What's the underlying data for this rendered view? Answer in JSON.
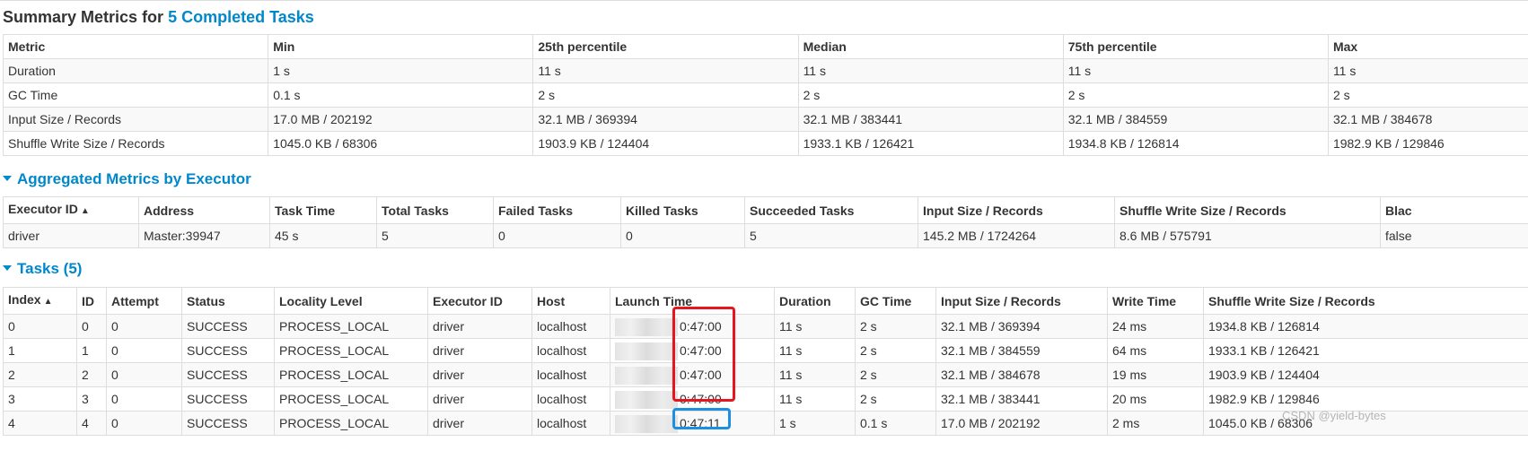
{
  "summary": {
    "title_prefix": "Summary Metrics for ",
    "title_link": "5 Completed Tasks",
    "headers": [
      "Metric",
      "Min",
      "25th percentile",
      "Median",
      "75th percentile",
      "Max"
    ],
    "rows": [
      [
        "Duration",
        "1 s",
        "11 s",
        "11 s",
        "11 s",
        "11 s"
      ],
      [
        "GC Time",
        "0.1 s",
        "2 s",
        "2 s",
        "2 s",
        "2 s"
      ],
      [
        "Input Size / Records",
        "17.0 MB / 202192",
        "32.1 MB / 369394",
        "32.1 MB / 383441",
        "32.1 MB / 384559",
        "32.1 MB / 384678"
      ],
      [
        "Shuffle Write Size / Records",
        "1045.0 KB / 68306",
        "1903.9 KB / 124404",
        "1933.1 KB / 126421",
        "1934.8 KB / 126814",
        "1982.9 KB / 129846"
      ]
    ]
  },
  "executors": {
    "title": "Aggregated Metrics by Executor",
    "headers": [
      "Executor ID",
      "Address",
      "Task Time",
      "Total Tasks",
      "Failed Tasks",
      "Killed Tasks",
      "Succeeded Tasks",
      "Input Size / Records",
      "Shuffle Write Size / Records",
      "Blac"
    ],
    "sort_indicator": "▲",
    "rows": [
      [
        "driver",
        "Master:39947",
        "45 s",
        "5",
        "0",
        "0",
        "5",
        "145.2 MB / 1724264",
        "8.6 MB / 575791",
        "false"
      ]
    ]
  },
  "tasks": {
    "title": "Tasks (5)",
    "headers": [
      "Index",
      "ID",
      "Attempt",
      "Status",
      "Locality Level",
      "Executor ID",
      "Host",
      "Launch Time",
      "Duration",
      "GC Time",
      "Input Size / Records",
      "Write Time",
      "Shuffle Write Size / Records"
    ],
    "sort_indicator": "▲",
    "rows": [
      [
        "0",
        "0",
        "0",
        "SUCCESS",
        "PROCESS_LOCAL",
        "driver",
        "localhost",
        "0:47:00",
        "11 s",
        "2 s",
        "32.1 MB / 369394",
        "24 ms",
        "1934.8 KB / 126814"
      ],
      [
        "1",
        "1",
        "0",
        "SUCCESS",
        "PROCESS_LOCAL",
        "driver",
        "localhost",
        "0:47:00",
        "11 s",
        "2 s",
        "32.1 MB / 384559",
        "64 ms",
        "1933.1 KB / 126421"
      ],
      [
        "2",
        "2",
        "0",
        "SUCCESS",
        "PROCESS_LOCAL",
        "driver",
        "localhost",
        "0:47:00",
        "11 s",
        "2 s",
        "32.1 MB / 384678",
        "19 ms",
        "1903.9 KB / 124404"
      ],
      [
        "3",
        "3",
        "0",
        "SUCCESS",
        "PROCESS_LOCAL",
        "driver",
        "localhost",
        "0:47:00",
        "11 s",
        "2 s",
        "32.1 MB / 383441",
        "20 ms",
        "1982.9 KB / 129846"
      ],
      [
        "4",
        "4",
        "0",
        "SUCCESS",
        "PROCESS_LOCAL",
        "driver",
        "localhost",
        "0:47:11",
        "1 s",
        "0.1 s",
        "17.0 MB / 202192",
        "2 ms",
        "1045.0 KB / 68306"
      ]
    ]
  },
  "watermark": "CSDN @yield-bytes",
  "colors": {
    "link": "#0088cc",
    "highlight_red": "#e8141e",
    "highlight_blue": "#1d8fe1",
    "border": "#dddddd",
    "stripe": "#f9f9f9"
  }
}
